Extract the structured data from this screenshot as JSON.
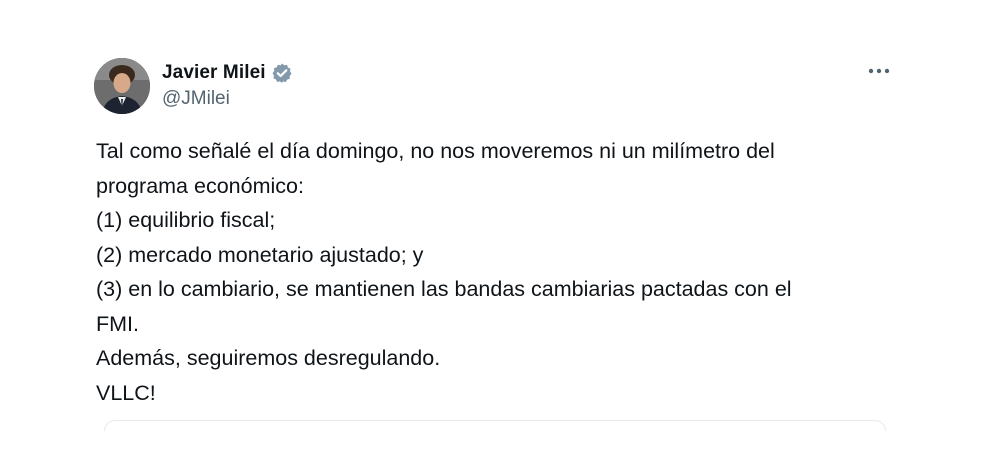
{
  "author": {
    "name": "Javier Milei",
    "handle": "@JMilei",
    "verified": true,
    "verified_icon": "verified-badge-icon",
    "avatar_icon": "avatar"
  },
  "menu": {
    "more_icon": "more-options-icon"
  },
  "tweet": {
    "lines": [
      "Tal como señalé el día domingo, no nos moveremos ni un milímetro del",
      "programa económico:",
      "(1) equilibrio fiscal;",
      "(2) mercado monetario ajustado; y",
      "(3) en lo cambiario, se mantienen las bandas cambiarias pactadas con el",
      "FMI.",
      "Además, seguiremos desregulando.",
      "VLLC!"
    ]
  },
  "colors": {
    "text": "#0f1419",
    "secondary_text": "#536471",
    "verified": "#829aab",
    "divider": "#e6e9eb"
  }
}
